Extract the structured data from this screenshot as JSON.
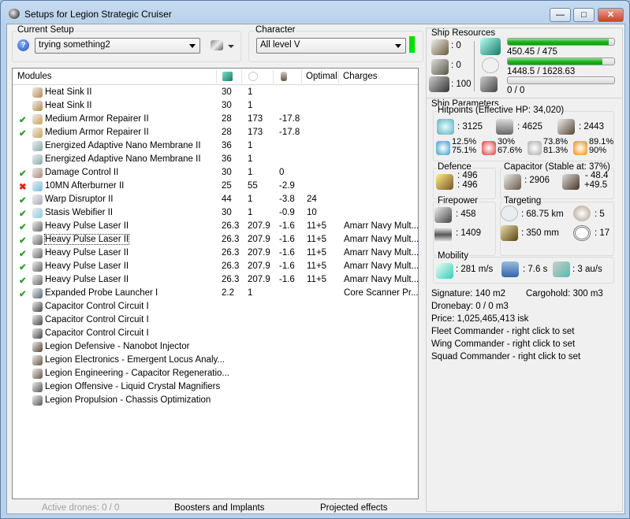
{
  "window": {
    "title": "Setups for Legion Strategic Cruiser",
    "min": "—",
    "max": "□",
    "close": "✕"
  },
  "setup": {
    "label": "Current Setup",
    "value": "trying something2"
  },
  "character": {
    "label": "Character",
    "value": "All level V",
    "status_color": "#00e000"
  },
  "modules": {
    "headers": [
      "Modules",
      "",
      "",
      "",
      "Optimal",
      "Charges"
    ],
    "rows": [
      {
        "status": "",
        "name": "Heat Sink II",
        "c1": "30",
        "c2": "1",
        "c3": "",
        "opt": "",
        "charges": ""
      },
      {
        "status": "",
        "name": "Heat Sink II",
        "c1": "30",
        "c2": "1",
        "c3": "",
        "opt": "",
        "charges": ""
      },
      {
        "status": "ok",
        "name": "Medium Armor Repairer II",
        "c1": "28",
        "c2": "173",
        "c3": "-17.8",
        "opt": "",
        "charges": ""
      },
      {
        "status": "ok",
        "name": "Medium Armor Repairer II",
        "c1": "28",
        "c2": "173",
        "c3": "-17.8",
        "opt": "",
        "charges": ""
      },
      {
        "status": "",
        "name": "Energized Adaptive Nano Membrane II",
        "c1": "36",
        "c2": "1",
        "c3": "",
        "opt": "",
        "charges": ""
      },
      {
        "status": "",
        "name": "Energized Adaptive Nano Membrane II",
        "c1": "36",
        "c2": "1",
        "c3": "",
        "opt": "",
        "charges": ""
      },
      {
        "status": "ok",
        "name": "Damage Control II",
        "c1": "30",
        "c2": "1",
        "c3": "0",
        "opt": "",
        "charges": ""
      },
      {
        "status": "bad",
        "name": "10MN Afterburner II",
        "c1": "25",
        "c2": "55",
        "c3": "-2.9",
        "opt": "",
        "charges": ""
      },
      {
        "status": "ok",
        "name": "Warp Disruptor II",
        "c1": "44",
        "c2": "1",
        "c3": "-3.8",
        "opt": "24",
        "charges": ""
      },
      {
        "status": "ok",
        "name": "Stasis Webifier II",
        "c1": "30",
        "c2": "1",
        "c3": "-0.9",
        "opt": "10",
        "charges": ""
      },
      {
        "status": "ok",
        "name": "Heavy Pulse Laser II",
        "c1": "26.3",
        "c2": "207.9",
        "c3": "-1.6",
        "opt": "11+5",
        "charges": "Amarr Navy Mult..."
      },
      {
        "status": "ok",
        "name": "Heavy Pulse Laser II",
        "c1": "26.3",
        "c2": "207.9",
        "c3": "-1.6",
        "opt": "11+5",
        "charges": "Amarr Navy Mult..."
      },
      {
        "status": "ok",
        "name": "Heavy Pulse Laser II",
        "c1": "26.3",
        "c2": "207.9",
        "c3": "-1.6",
        "opt": "11+5",
        "charges": "Amarr Navy Mult..."
      },
      {
        "status": "ok",
        "name": "Heavy Pulse Laser II",
        "c1": "26.3",
        "c2": "207.9",
        "c3": "-1.6",
        "opt": "11+5",
        "charges": "Amarr Navy Mult..."
      },
      {
        "status": "ok",
        "name": "Heavy Pulse Laser II",
        "c1": "26.3",
        "c2": "207.9",
        "c3": "-1.6",
        "opt": "11+5",
        "charges": "Amarr Navy Mult..."
      },
      {
        "status": "ok",
        "name": "Expanded Probe Launcher I",
        "c1": "2.2",
        "c2": "1",
        "c3": "",
        "opt": "",
        "charges": "Core Scanner Pr..."
      },
      {
        "status": "",
        "name": "Capacitor Control Circuit I",
        "c1": "",
        "c2": "",
        "c3": "",
        "opt": "",
        "charges": ""
      },
      {
        "status": "",
        "name": "Capacitor Control Circuit I",
        "c1": "",
        "c2": "",
        "c3": "",
        "opt": "",
        "charges": ""
      },
      {
        "status": "",
        "name": "Capacitor Control Circuit I",
        "c1": "",
        "c2": "",
        "c3": "",
        "opt": "",
        "charges": ""
      },
      {
        "status": "",
        "name": "Legion Defensive - Nanobot Injector",
        "c1": "",
        "c2": "",
        "c3": "",
        "opt": "",
        "charges": ""
      },
      {
        "status": "",
        "name": "Legion Electronics - Emergent Locus Analy...",
        "c1": "",
        "c2": "",
        "c3": "",
        "opt": "",
        "charges": ""
      },
      {
        "status": "",
        "name": "Legion Engineering - Capacitor Regeneratio...",
        "c1": "",
        "c2": "",
        "c3": "",
        "opt": "",
        "charges": ""
      },
      {
        "status": "",
        "name": "Legion Offensive - Liquid Crystal Magnifiers",
        "c1": "",
        "c2": "",
        "c3": "",
        "opt": "",
        "charges": ""
      },
      {
        "status": "",
        "name": "Legion Propulsion - Chassis Optimization",
        "c1": "",
        "c2": "",
        "c3": "",
        "opt": "",
        "charges": ""
      }
    ]
  },
  "status_marks": {
    "ok": "✔",
    "bad": "✖"
  },
  "bottom": {
    "drones": "Active drones: 0 / 0",
    "boosters": "Boosters and Implants",
    "projected": "Projected effects"
  },
  "resources": {
    "label": "Ship Resources",
    "turrets": ": 0",
    "launchers": ": 0",
    "calibration": ": 100",
    "cpu": "450.45 / 475",
    "cpu_fraction": 0.948,
    "pg": "1448.5 / 1628.63",
    "pg_fraction": 0.889,
    "drone_bw": "0 / 0",
    "drone_fraction": 0
  },
  "params": {
    "label": "Ship Parameters",
    "hp_label": "Hitpoints (Effective HP: 34,020)",
    "shield": ": 3125",
    "armor": ": 4625",
    "structure": ": 2443",
    "res": [
      [
        "12.5%",
        "75.1%"
      ],
      [
        "30%",
        "67.6%"
      ],
      [
        "73.8%",
        "81.3%"
      ],
      [
        "89.1%",
        "90%"
      ]
    ],
    "defence_label": "Defence",
    "def1": ": 496",
    "def2": ": 496",
    "cap_label": "Capacitor (Stable at: 37%)",
    "cap": ": 2906",
    "cap_use": "- 48.4",
    "cap_regen": "+49.5",
    "fire_label": "Firepower",
    "dps": ": 458",
    "volley": ": 1409",
    "target_label": "Targeting",
    "range": ": 68.75 km",
    "targets": ": 5",
    "scan": ": 350 mm",
    "sensor": ": 17",
    "mob_label": "Mobility",
    "speed": ": 281 m/s",
    "align": ": 7.6 s",
    "warp": ": 3 au/s",
    "signature": "Signature: 140 m2",
    "cargo": "Cargohold: 300 m3",
    "dronebay": "Dronebay: 0 / 0 m3",
    "price": "Price: 1,025,465,413 isk",
    "fleet": "Fleet Commander - right click to set",
    "wing": "Wing Commander - right click to set",
    "squad": "Squad Commander - right click to set"
  }
}
